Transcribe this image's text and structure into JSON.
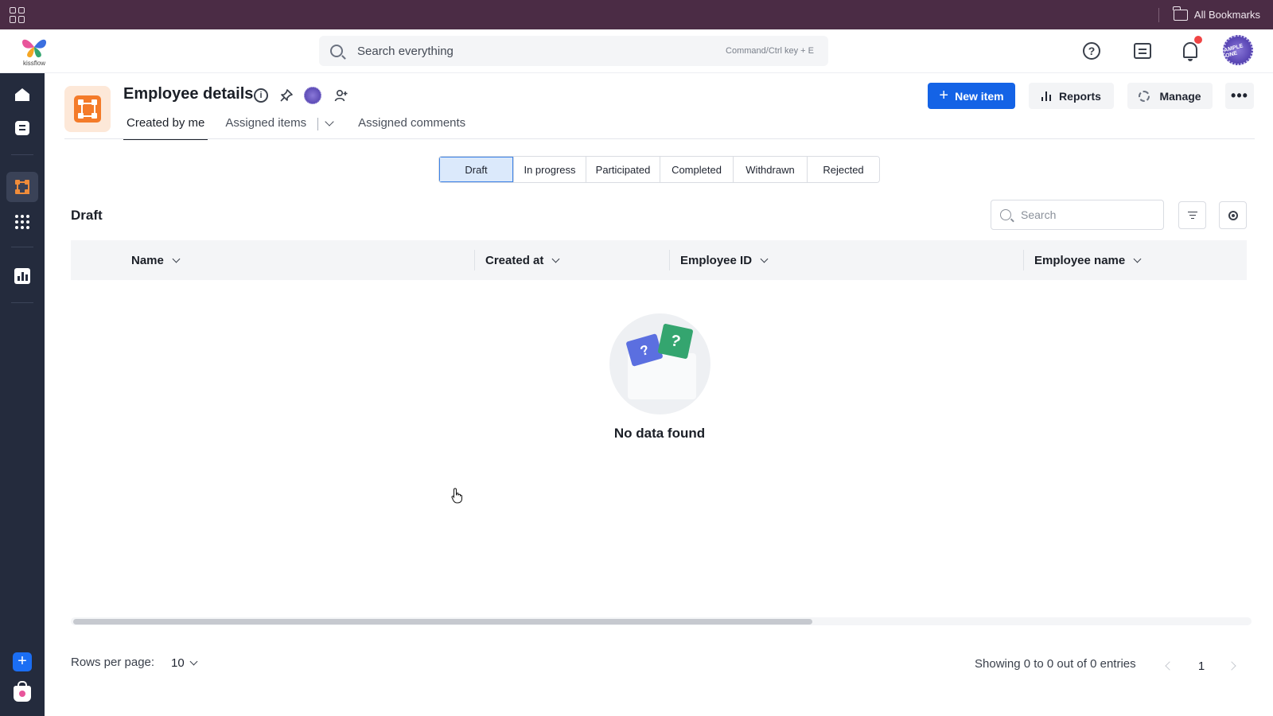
{
  "browser": {
    "bookmarks_label": "All Bookmarks"
  },
  "header": {
    "logo_text": "kissflow",
    "search_placeholder": "Search everything",
    "search_shortcut": "Command/Ctrl key + E",
    "avatar_text": "AMPLE ONE"
  },
  "sidebar": {
    "items": [
      {
        "name": "home",
        "icon": "home-icon"
      },
      {
        "name": "tasks",
        "icon": "task-icon"
      },
      {
        "name": "process",
        "icon": "flow-icon",
        "active": true
      },
      {
        "name": "apps",
        "icon": "grid-dots-icon"
      },
      {
        "name": "analytics",
        "icon": "chart-icon"
      }
    ],
    "add_label": "+"
  },
  "page": {
    "title": "Employee details",
    "tabs": [
      {
        "label": "Created by me",
        "active": true
      },
      {
        "label": "Assigned items",
        "active": false
      },
      {
        "label": "Assigned comments",
        "active": false
      }
    ],
    "actions": {
      "new_item": "New item",
      "reports": "Reports",
      "manage": "Manage",
      "more": "•••"
    }
  },
  "status_filter": {
    "options": [
      "Draft",
      "In progress",
      "Participated",
      "Completed",
      "Withdrawn",
      "Rejected"
    ],
    "selected": "Draft"
  },
  "list": {
    "section_title": "Draft",
    "search_placeholder": "Search",
    "columns": [
      "Name",
      "Created at",
      "Employee ID",
      "Employee name"
    ],
    "rows": [],
    "empty_message": "No data found",
    "empty_card_glyph": "?"
  },
  "pagination": {
    "rows_per_page_label": "Rows per page:",
    "rows_per_page": "10",
    "showing_text": "Showing 0 to 0 out of 0 entries",
    "current_page": "1"
  },
  "colors": {
    "primary": "#1463e6",
    "sidebar_bg": "#242b3d",
    "bookmarks_bg": "#4b2c45",
    "process_accent": "#f47b2a"
  }
}
